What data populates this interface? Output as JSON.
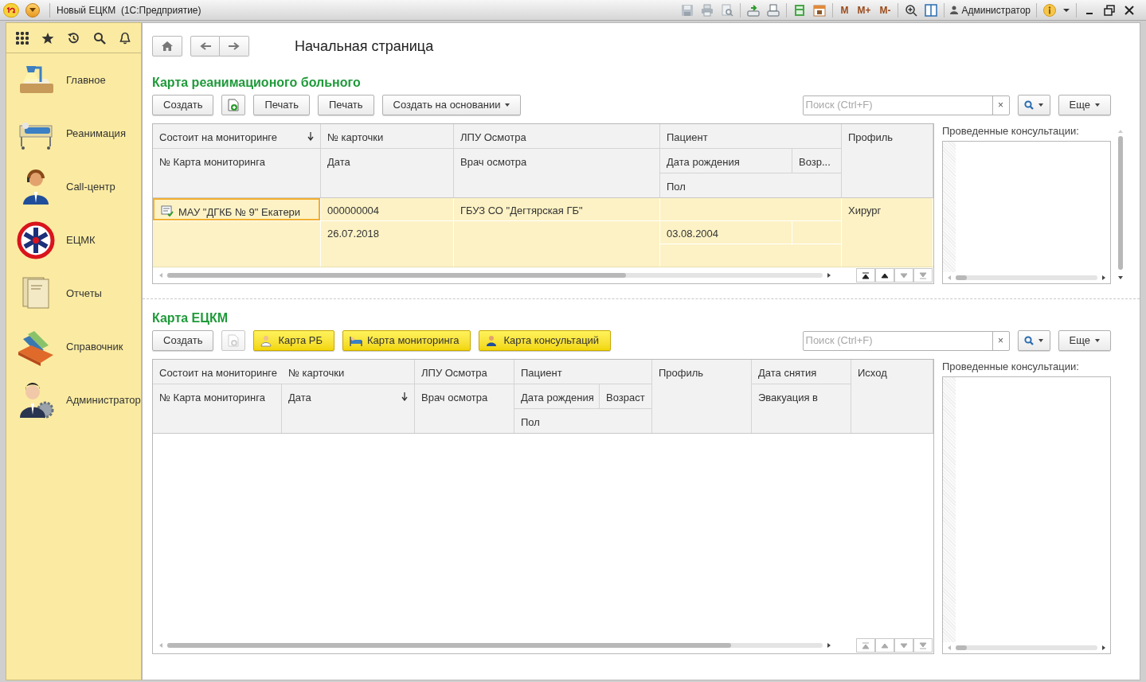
{
  "titlebar": {
    "title": "Новый ЕЦКМ  (1С:Предприятие)",
    "memory_buttons": [
      "M",
      "M+",
      "M-"
    ],
    "user": "Администратор"
  },
  "sidebar": {
    "sections": [
      {
        "label": "Главное",
        "kind": "lamp"
      },
      {
        "label": "Реанимация",
        "kind": "bed"
      },
      {
        "label": "Call-центр",
        "kind": "operator"
      },
      {
        "label": "ЕЦМК",
        "kind": "emblem"
      },
      {
        "label": "Отчеты",
        "kind": "folder"
      },
      {
        "label": "Справочник",
        "kind": "cardbox"
      },
      {
        "label": "Администратор",
        "kind": "admin"
      }
    ]
  },
  "page": {
    "title": "Начальная страница"
  },
  "panels": [
    {
      "title": "Карта реанимационого больного",
      "buttons": [
        {
          "kind": "plain",
          "label": "Создать"
        },
        {
          "kind": "icon",
          "disabled": false
        },
        {
          "kind": "plain",
          "label": "Печать"
        },
        {
          "kind": "plain",
          "label": "Печать"
        },
        {
          "kind": "dropdown",
          "label": "Создать на основании"
        }
      ],
      "search": {
        "placeholder": "Поиск (Ctrl+F)",
        "clear": "×"
      },
      "more": "Еще",
      "columns": [
        {
          "lines": [
            [
              {
                "label": "Состоит на мониторинге",
                "sorted": true
              }
            ],
            [
              {
                "label": "№ Карта мониторинга",
                "sorted": false
              }
            ]
          ]
        },
        {
          "lines": [
            [
              {
                "label": "№ карточки",
                "sorted": false
              }
            ],
            [
              {
                "label": "Дата",
                "sorted": false
              }
            ]
          ]
        },
        {
          "lines": [
            [
              {
                "label": "ЛПУ Осмотра",
                "sorted": false
              }
            ],
            [
              {
                "label": "Врач осмотра",
                "sorted": false
              }
            ]
          ]
        },
        {
          "lines": [
            [
              {
                "label": "Пациент",
                "sorted": false
              }
            ],
            [
              {
                "label": "Дата рождения",
                "sorted": false
              },
              {
                "label": "Возр...",
                "sorted": false
              }
            ],
            [
              {
                "label": "Пол",
                "sorted": false
              }
            ]
          ]
        },
        {
          "lines": [
            [
              {
                "label": "Профиль",
                "sorted": false
              }
            ]
          ]
        }
      ],
      "rows": [
        {
          "selected": true,
          "monitoring": "МАУ \"ДГКБ № 9\" Екатери",
          "card_no": "000000004",
          "date": "26.07.2018",
          "lpu": "ГБУЗ СО \"Дегтярская ГБ\"",
          "birth_date": "03.08.2004",
          "profile": "Хирург"
        }
      ],
      "side_label": "Проведенные консультации:"
    },
    {
      "title": "Карта ЕЦКМ",
      "buttons": [
        {
          "kind": "plain",
          "label": "Создать"
        },
        {
          "kind": "icon",
          "disabled": true
        },
        {
          "kind": "accent",
          "label": "Карта РБ"
        },
        {
          "kind": "accent",
          "label": "Карта мониторинга"
        },
        {
          "kind": "accent",
          "label": "Карта консультаций"
        }
      ],
      "search": {
        "placeholder": "Поиск (Ctrl+F)",
        "clear": "×"
      },
      "more": "Еще",
      "columns": [
        {
          "lines": [
            [
              {
                "label": "Состоит на мониторинге",
                "sorted": false
              }
            ],
            [
              {
                "label": "№ Карта мониторинга",
                "sorted": false
              }
            ]
          ]
        },
        {
          "lines": [
            [
              {
                "label": "№ карточки",
                "sorted": false
              }
            ],
            [
              {
                "label": "Дата",
                "sorted": true
              }
            ]
          ]
        },
        {
          "lines": [
            [
              {
                "label": "ЛПУ Осмотра",
                "sorted": false
              }
            ],
            [
              {
                "label": "Врач осмотра",
                "sorted": false
              }
            ]
          ]
        },
        {
          "lines": [
            [
              {
                "label": "Пациент",
                "sorted": false
              }
            ],
            [
              {
                "label": "Дата рождения",
                "sorted": false
              },
              {
                "label": "Возраст",
                "sorted": false
              }
            ],
            [
              {
                "label": "Пол",
                "sorted": false
              }
            ]
          ]
        },
        {
          "lines": [
            [
              {
                "label": "Профиль",
                "sorted": false
              }
            ]
          ]
        },
        {
          "lines": [
            [
              {
                "label": "Дата снятия",
                "sorted": false
              }
            ],
            [
              {
                "label": "Эвакуация в",
                "sorted": false
              }
            ]
          ]
        },
        {
          "lines": [
            [
              {
                "label": "Исход",
                "sorted": false
              }
            ]
          ]
        }
      ],
      "side_label": "Проведенные консультации:"
    }
  ]
}
